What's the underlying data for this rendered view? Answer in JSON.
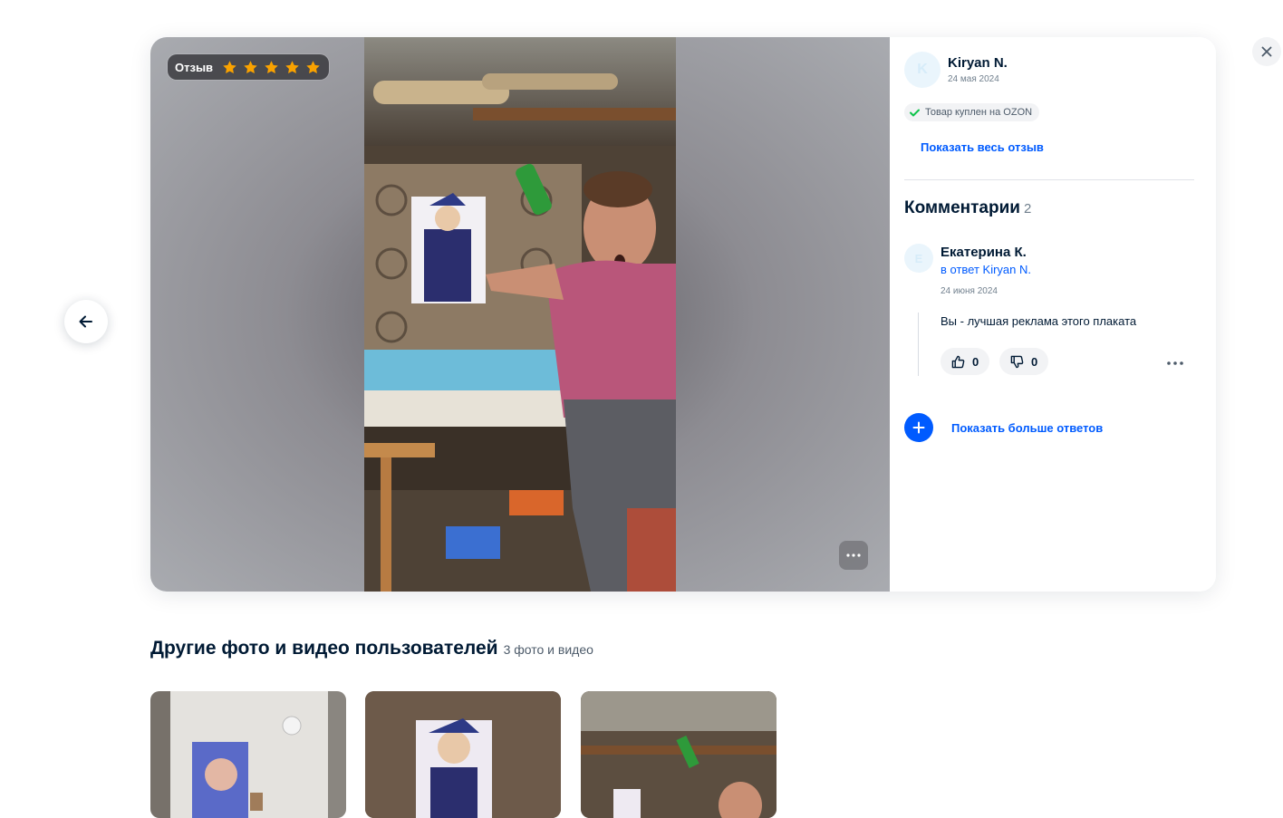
{
  "review": {
    "badge_label": "Отзыв",
    "rating": 5,
    "rating_max": 5,
    "author": {
      "initial": "K",
      "name": "Kiryan N.",
      "date": "24 мая 2024"
    },
    "purchased_label": "Товар куплен на OZON",
    "show_full_label": "Показать весь отзыв"
  },
  "comments": {
    "title": "Комментарии",
    "count": "2",
    "items": [
      {
        "initial": "E",
        "author": "Екатерина К.",
        "reply_to": "в ответ Kiryan N.",
        "date": "24 июня 2024",
        "text": "Вы - лучшая реклама этого плаката",
        "likes": "0",
        "dislikes": "0"
      }
    ],
    "more_replies_label": "Показать больше ответов"
  },
  "gallery": {
    "title": "Другие фото и видео пользователей",
    "count_label": "3 фото и видео"
  },
  "colors": {
    "accent": "#005bff",
    "star": "#f9a200",
    "text": "#001a34",
    "muted": "#707f8d",
    "check": "#10c44c"
  },
  "icons": {
    "close": "close-icon",
    "prev": "arrow-left-icon",
    "star": "star-icon",
    "check": "check-icon",
    "like": "thumb-up-icon",
    "dislike": "thumb-down-icon",
    "more": "more-dots-icon",
    "plus": "plus-icon"
  }
}
